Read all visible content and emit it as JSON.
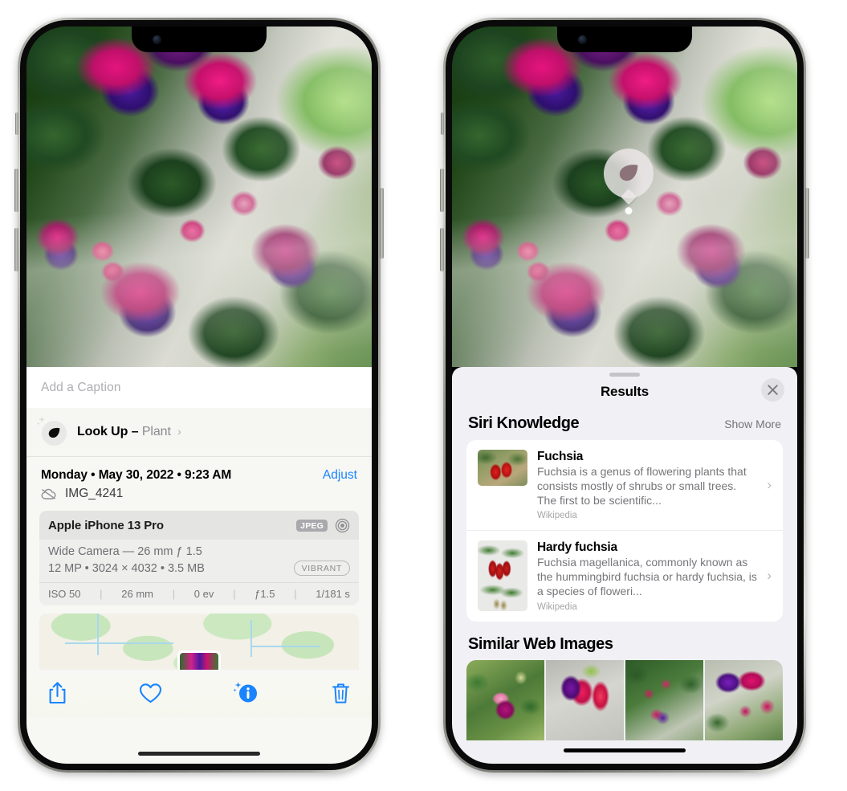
{
  "left_phone": {
    "name": "iphone-photos-info",
    "caption_placeholder": "Add a Caption",
    "lookup": {
      "label": "Look Up",
      "dash": "–",
      "subject": "Plant",
      "chevron": "›",
      "icon": "leaf-sparkle-icon"
    },
    "date": "Monday • May 30, 2022 • 9:23 AM",
    "adjust_label": "Adjust",
    "filename": "IMG_4241",
    "cloud_icon": "icloud-slash-icon",
    "exif": {
      "device": "Apple iPhone 13 Pro",
      "format_chip": "JPEG",
      "lens_icon": "aperture-icon",
      "lens_line": "Wide Camera — 26 mm ƒ 1.5",
      "specs_line": "12 MP • 3024 × 4032 • 3.5 MB",
      "vibrant_chip": "VIBRANT",
      "settings": [
        "ISO 50",
        "26 mm",
        "0 ev",
        "ƒ1.5",
        "1/181 s"
      ]
    },
    "toolbar": [
      {
        "name": "share-button",
        "icon": "share-icon"
      },
      {
        "name": "favorite-button",
        "icon": "heart-icon"
      },
      {
        "name": "info-button",
        "icon": "info-sparkle-icon"
      },
      {
        "name": "delete-button",
        "icon": "trash-icon"
      }
    ],
    "accent_color": "#1a84ff"
  },
  "right_phone": {
    "name": "iphone-visual-lookup-results",
    "badge_icon": "leaf-icon",
    "sheet": {
      "title": "Results",
      "close_icon": "close-icon",
      "siri_section": {
        "title": "Siri Knowledge",
        "action": "Show More",
        "cards": [
          {
            "title": "Fuchsia",
            "description": "Fuchsia is a genus of flowering plants that consists mostly of shrubs or small trees. The first to be scientific...",
            "source": "Wikipedia",
            "thumb": "fuchsia-red-flowers-thumb",
            "chevron": "›"
          },
          {
            "title": "Hardy fuchsia",
            "description": "Fuchsia magellanica, commonly known as the hummingbird fuchsia or hardy fuchsia, is a species of floweri...",
            "source": "Wikipedia",
            "thumb": "hardy-fuchsia-branch-thumb",
            "chevron": "›"
          }
        ]
      },
      "web_section": {
        "title": "Similar Web Images",
        "thumbs": [
          "web-image-magenta-fuchsia",
          "web-image-red-pink-fuchsia",
          "web-image-fuchsia-bush",
          "web-image-purple-fuchsia"
        ]
      }
    }
  }
}
